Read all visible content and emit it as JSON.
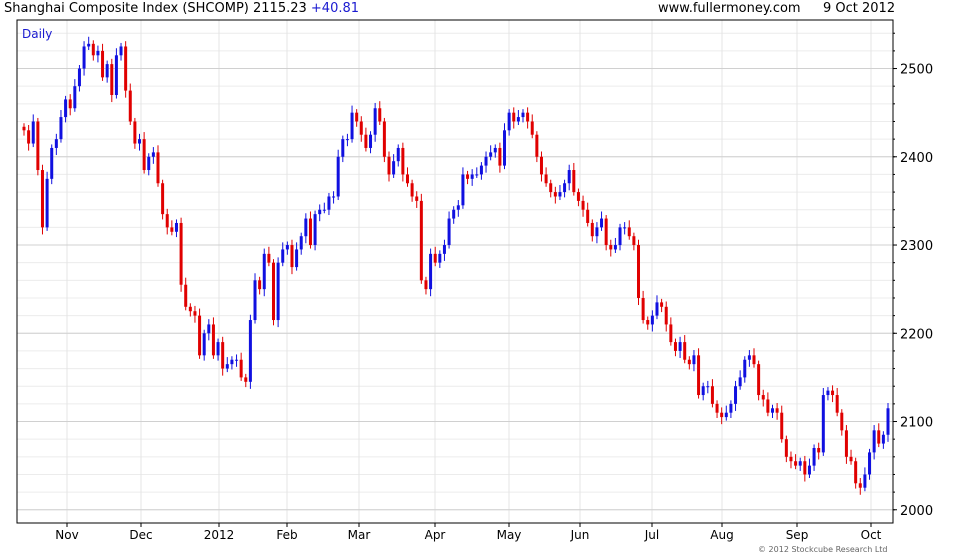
{
  "header": {
    "title": "Shanghai Composite Index (SHCOMP) 2115.23",
    "change": "+40.81",
    "site": "www.fullermoney.com",
    "date": "9 Oct 2012"
  },
  "period_label": "Daily",
  "credit": "© 2012 Stockcube Research Ltd",
  "colors": {
    "up": "#1010e0",
    "down": "#e00000",
    "grid": "#d0d0d0",
    "frame": "#000000"
  },
  "chart_data": {
    "type": "candlestick",
    "title": "Shanghai Composite Index (SHCOMP) 2115.23 +40.81",
    "ylabel": "",
    "xlabel": "",
    "ylim": [
      1985,
      2555
    ],
    "y_ticks": [
      2000,
      2100,
      2200,
      2300,
      2400,
      2500
    ],
    "x_ticks": [
      "Nov",
      "Dec",
      "2012",
      "Feb",
      "Mar",
      "Apr",
      "May",
      "Jun",
      "Jul",
      "Aug",
      "Sep",
      "Oct"
    ],
    "grid": true,
    "y_axis_side": "right",
    "series": [
      {
        "name": "SHCOMP",
        "values": [
          2430,
          2415,
          2440,
          2385,
          2320,
          2375,
          2410,
          2420,
          2445,
          2465,
          2455,
          2480,
          2500,
          2525,
          2528,
          2515,
          2520,
          2490,
          2505,
          2470,
          2515,
          2525,
          2475,
          2440,
          2415,
          2420,
          2385,
          2400,
          2405,
          2370,
          2335,
          2320,
          2315,
          2325,
          2255,
          2230,
          2225,
          2220,
          2175,
          2200,
          2210,
          2175,
          2190,
          2160,
          2165,
          2170,
          2170,
          2150,
          2145,
          2215,
          2260,
          2250,
          2290,
          2280,
          2215,
          2280,
          2295,
          2300,
          2275,
          2295,
          2310,
          2330,
          2300,
          2335,
          2340,
          2340,
          2355,
          2355,
          2400,
          2420,
          2420,
          2450,
          2440,
          2425,
          2410,
          2425,
          2455,
          2440,
          2400,
          2380,
          2395,
          2410,
          2380,
          2370,
          2355,
          2350,
          2260,
          2250,
          2290,
          2280,
          2290,
          2300,
          2330,
          2340,
          2345,
          2380,
          2375,
          2380,
          2380,
          2390,
          2400,
          2405,
          2410,
          2390,
          2430,
          2450,
          2440,
          2445,
          2450,
          2440,
          2425,
          2400,
          2380,
          2370,
          2360,
          2355,
          2360,
          2370,
          2385,
          2360,
          2350,
          2340,
          2325,
          2310,
          2320,
          2330,
          2300,
          2295,
          2300,
          2320,
          2320,
          2310,
          2300,
          2240,
          2215,
          2210,
          2220,
          2235,
          2230,
          2210,
          2190,
          2180,
          2190,
          2170,
          2165,
          2175,
          2130,
          2140,
          2140,
          2120,
          2110,
          2105,
          2110,
          2120,
          2140,
          2150,
          2170,
          2175,
          2165,
          2130,
          2125,
          2110,
          2115,
          2110,
          2080,
          2060,
          2055,
          2050,
          2055,
          2040,
          2050,
          2070,
          2065,
          2130,
          2135,
          2130,
          2110,
          2090,
          2060,
          2055,
          2030,
          2025,
          2040,
          2065,
          2090,
          2075,
          2085,
          2115
        ]
      }
    ]
  }
}
